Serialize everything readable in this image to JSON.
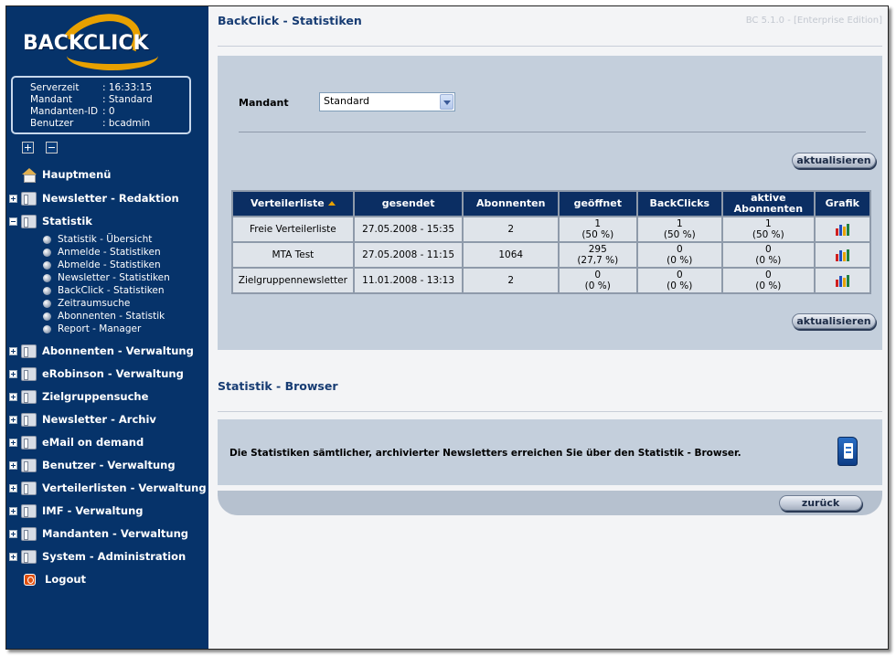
{
  "sidebar": {
    "logo_text": "BACKCLICK",
    "info": [
      {
        "key": "Serverzeit",
        "value": ": 16:33:15"
      },
      {
        "key": "Mandant",
        "value": ": Standard"
      },
      {
        "key": "Mandanten-ID",
        "value": ": 0"
      },
      {
        "key": "Benutzer",
        "value": ": bcadmin"
      }
    ],
    "menu": {
      "hauptmenue": "Hauptmenü",
      "newsletter_redaktion": "Newsletter - Redaktion",
      "statistik": "Statistik",
      "statistik_sub": [
        "Statistik - Übersicht",
        "Anmelde - Statistiken",
        "Abmelde - Statistiken",
        "Newsletter - Statistiken",
        "BackClick - Statistiken",
        "Zeitraumsuche",
        "Abonnenten - Statistik",
        "Report - Manager"
      ],
      "abonnenten_verwaltung": "Abonnenten - Verwaltung",
      "erobinson_verwaltung": "eRobinson - Verwaltung",
      "zielgruppensuche": "Zielgruppensuche",
      "newsletter_archiv": "Newsletter - Archiv",
      "email_on_demand": "eMail on demand",
      "benutzer_verwaltung": "Benutzer - Verwaltung",
      "verteilerlisten_verwaltung": "Verteilerlisten - Verwaltung",
      "imf_verwaltung": "IMF - Verwaltung",
      "mandanten_verwaltung": "Mandanten - Verwaltung",
      "system_administration": "System - Administration",
      "logout": "Logout"
    }
  },
  "header": {
    "title": "BackClick - Statistiken",
    "version": "BC 5.1.0 - [Enterprise Edition]"
  },
  "filter": {
    "mandant_label": "Mandant",
    "mandant_value": "Standard"
  },
  "buttons": {
    "refresh": "aktualisieren",
    "back": "zurück"
  },
  "table": {
    "headers": {
      "list": "Verteilerliste",
      "sent": "gesendet",
      "subscribers": "Abonnenten",
      "opened": "geöffnet",
      "backclicks": "BackClicks",
      "active_1": "aktive",
      "active_2": "Abonnenten",
      "chart": "Grafik"
    },
    "rows": [
      {
        "list": "Freie Verteilerliste",
        "sent": "27.05.2008 - 15:35",
        "subscribers": "2",
        "opened_n": "1",
        "opened_p": "(50 %)",
        "clicks_n": "1",
        "clicks_p": "(50 %)",
        "active_n": "1",
        "active_p": "(50 %)"
      },
      {
        "list": "MTA Test",
        "sent": "27.05.2008 - 11:15",
        "subscribers": "1064",
        "opened_n": "295",
        "opened_p": "(27,7 %)",
        "clicks_n": "0",
        "clicks_p": "(0 %)",
        "active_n": "0",
        "active_p": "(0 %)"
      },
      {
        "list": "Zielgruppennewsletter",
        "sent": "11.01.2008 - 13:13",
        "subscribers": "2",
        "opened_n": "0",
        "opened_p": "(0 %)",
        "clicks_n": "0",
        "clicks_p": "(0 %)",
        "active_n": "0",
        "active_p": "(0 %)"
      }
    ]
  },
  "browser_section": {
    "title": "Statistik - Browser",
    "text": "Die Statistiken sämtlicher, archivierter Newsletters erreichen Sie über den Statistik - Browser."
  },
  "colors": {
    "sidebar_bg": "#06336a",
    "accent_orange": "#e8a100",
    "table_header": "#0b2e63",
    "title_blue": "#173c73"
  }
}
